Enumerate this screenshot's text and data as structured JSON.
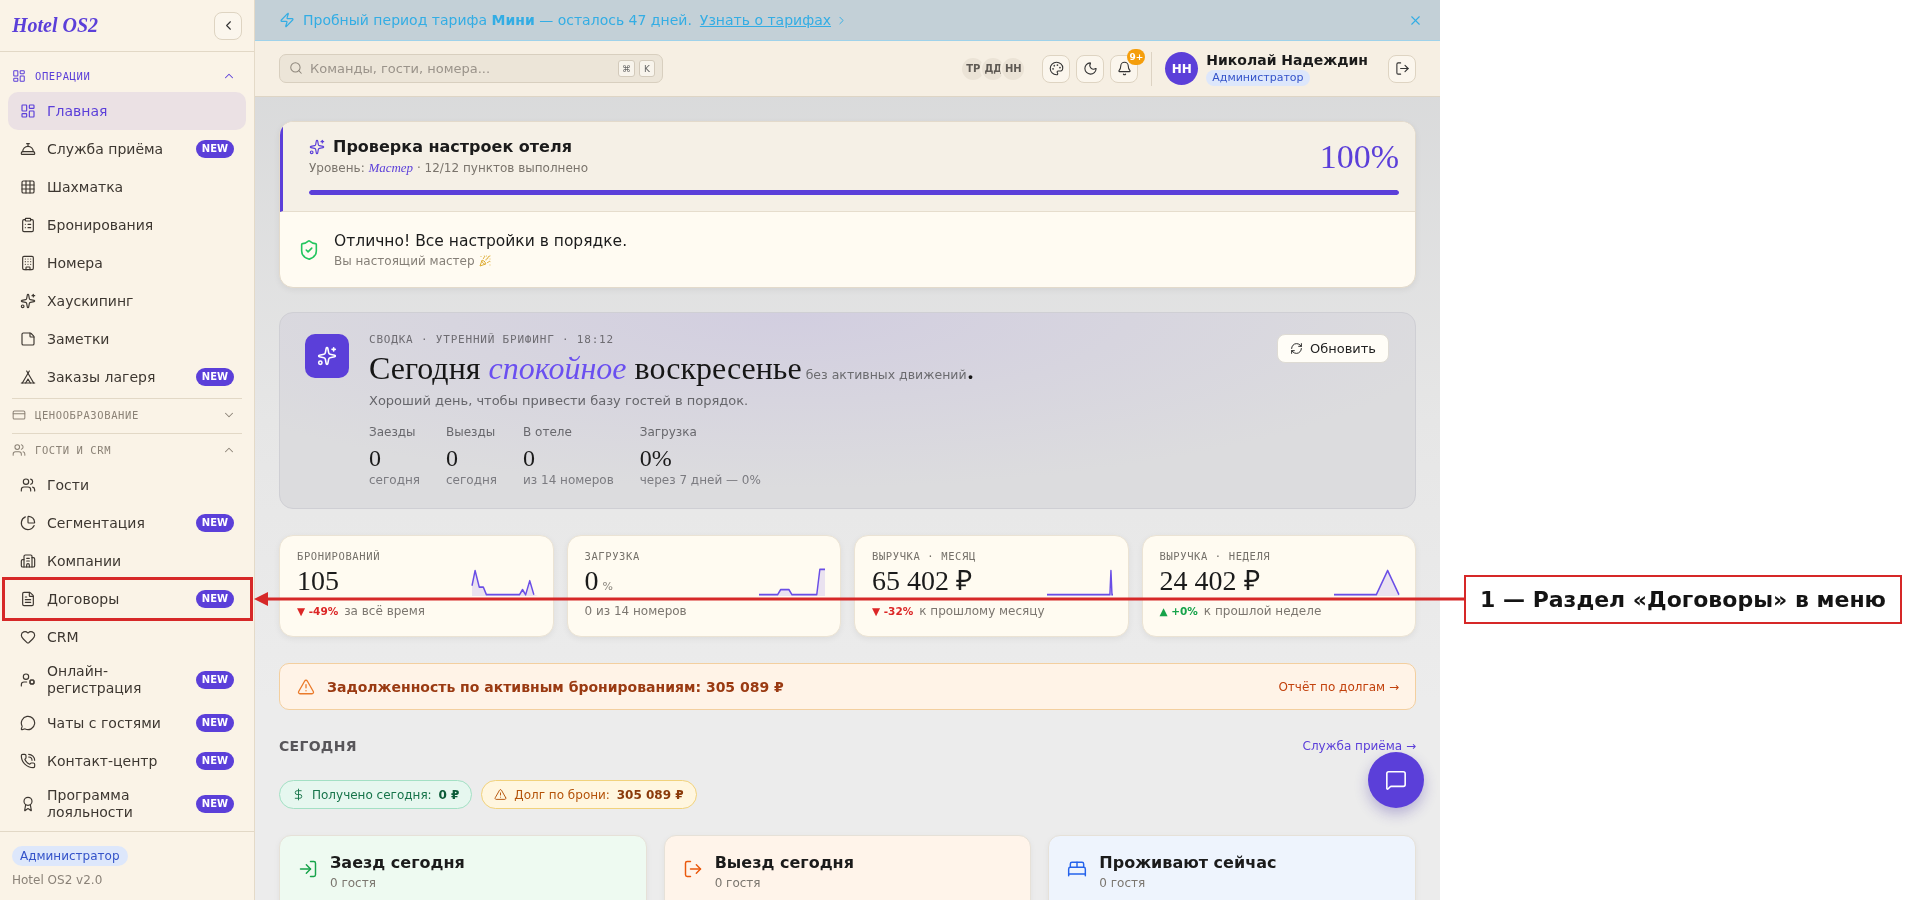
{
  "sidebar": {
    "logo": "Hotel OS2",
    "sections": [
      {
        "title": "ОПЕРАЦИИ",
        "expanded": true,
        "items": [
          {
            "label": "Главная",
            "selected": true,
            "highlighted": false
          },
          {
            "label": "Служба приёма",
            "badge": "NEW",
            "selected": false,
            "highlighted": false
          },
          {
            "label": "Шахматка",
            "selected": false,
            "highlighted": false
          },
          {
            "label": "Бронирования",
            "selected": false,
            "highlighted": false
          },
          {
            "label": "Номера",
            "selected": false,
            "highlighted": false
          },
          {
            "label": "Хаускипинг",
            "selected": false,
            "highlighted": false
          },
          {
            "label": "Заметки",
            "selected": false,
            "highlighted": false
          },
          {
            "label": "Заказы лагеря",
            "badge": "NEW",
            "selected": false,
            "highlighted": false
          }
        ]
      },
      {
        "title": "ЦЕНООБРАЗОВАНИЕ",
        "expanded": false
      },
      {
        "title": "ГОСТИ И CRM",
        "expanded": true,
        "items": [
          {
            "label": "Гости",
            "selected": false,
            "highlighted": false
          },
          {
            "label": "Сегментация",
            "badge": "NEW",
            "selected": false,
            "highlighted": false
          },
          {
            "label": "Компании",
            "selected": false,
            "highlighted": false
          },
          {
            "label": "Договоры",
            "badge": "NEW",
            "selected": false,
            "highlighted": true
          },
          {
            "label": "CRM",
            "selected": false,
            "highlighted": false
          },
          {
            "label": "Онлайн-регистрация",
            "badge": "NEW",
            "selected": false,
            "highlighted": false
          },
          {
            "label": "Чаты с гостями",
            "badge": "NEW",
            "selected": false,
            "highlighted": false
          },
          {
            "label": "Контакт-центр",
            "badge": "NEW",
            "selected": false,
            "highlighted": false
          },
          {
            "label": "Программа лояльности",
            "badge": "NEW",
            "selected": false,
            "highlighted": false
          }
        ]
      }
    ],
    "footer": {
      "role": "Администратор",
      "version": "Hotel OS2 v2.0"
    }
  },
  "banner": {
    "text": "Пробный период тарифа **Мини** — осталось 47 дней.",
    "link": "Узнать о тарифах"
  },
  "topbar": {
    "search_placeholder": "Команды, гости, номера...",
    "shortcut_keys": [
      "⌘",
      "K"
    ],
    "presence": [
      {
        "initials": "ТР"
      },
      {
        "initials": "ДД"
      },
      {
        "initials": "НН"
      }
    ],
    "notification_count": "9+",
    "user": {
      "initials": "НН",
      "name": "Николай Надеждин",
      "role": "Администратор"
    }
  },
  "setup_check": {
    "title": "Проверка настроек отеля",
    "subtitle": "Уровень: *Мастер* · 12/12 пунктов выполнено",
    "percent": "100%",
    "level": 1,
    "status_title": "Отлично! Все настройки в порядке.",
    "status_text": "Вы настоящий мастер"
  },
  "briefing": {
    "overline": "СВОДКА · УТРЕННИЙ БРИФИНГ · 18:12",
    "headline": "Сегодня *спокойное* воскресенье",
    "headline_note": "без активных движений",
    "headline_end": ".",
    "refresh_button": "Обновить",
    "summary": "Хороший день, чтобы привести базу гостей в порядок.",
    "stats": [
      {
        "label": "Заезды",
        "value": "0",
        "note": "сегодня"
      },
      {
        "label": "Выезды",
        "value": "0",
        "note": "сегодня"
      },
      {
        "label": "В отеле",
        "value": "0",
        "note": "из 14 номеров"
      },
      {
        "label": "Загрузка",
        "value": "0%",
        "note": "через 7 дней — 0%"
      }
    ]
  },
  "kpis": [
    {
      "label": "БРОНИРОВАНИЙ",
      "value": "105",
      "trend": {
        "kind": "down",
        "value": "▼ -49%",
        "text": "за всё время"
      }
    },
    {
      "label": "ЗАГРУЗКА",
      "value": "0",
      "unit": "%",
      "note": "0 из 14 номеров"
    },
    {
      "label": "ВЫРУЧКА · МЕСЯЦ",
      "value": "65 402 ₽",
      "trend": {
        "kind": "down",
        "value": "▼ -32%",
        "text": "к прошлому месяцу"
      }
    },
    {
      "label": "ВЫРУЧКА · НЕДЕЛЯ",
      "value": "24 402 ₽",
      "trend": {
        "kind": "up",
        "value": "▲ +0%",
        "text": "к прошлой неделе"
      }
    }
  ],
  "debt_alert": {
    "text": "Задолженность по активным бронированиям: **305 089 ₽**",
    "link": "Отчёт по долгам →"
  },
  "today": {
    "title": "СЕГОДНЯ",
    "link": "Служба приёма →",
    "chips": [
      {
        "kind": "received",
        "text": "Получено сегодня: **0 ₽**"
      },
      {
        "kind": "debt",
        "text": "Долг по брони: **305 089 ₽**"
      }
    ],
    "cards": [
      {
        "kind": "arrivals",
        "title": "Заезд сегодня",
        "subtitle": "0 гостя"
      },
      {
        "kind": "departures",
        "title": "Выезд сегодня",
        "subtitle": "0 гостя"
      },
      {
        "kind": "in_house",
        "title": "Проживают сейчас",
        "subtitle": "0 гостя"
      }
    ]
  },
  "annotation": {
    "label": "1 — Раздел «Договоры» в меню"
  }
}
